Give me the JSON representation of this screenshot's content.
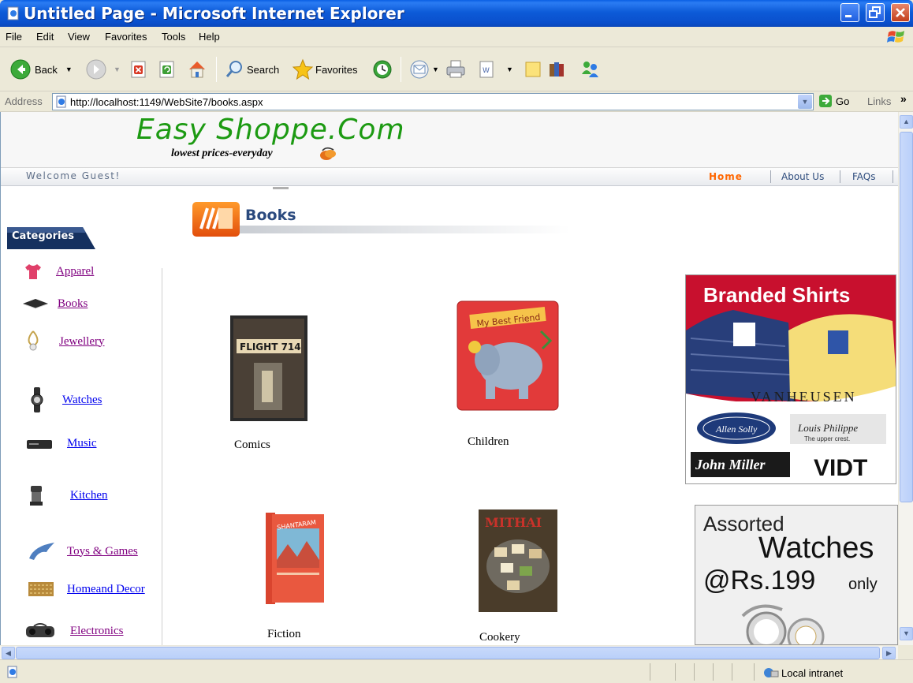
{
  "window": {
    "title": "Untitled Page - Microsoft Internet Explorer"
  },
  "menu": [
    "File",
    "Edit",
    "View",
    "Favorites",
    "Tools",
    "Help"
  ],
  "toolbar": {
    "back_label": "Back",
    "search_label": "Search",
    "favorites_label": "Favorites"
  },
  "address": {
    "label": "Address",
    "url": "http://localhost:1149/WebSite7/books.aspx",
    "go_label": "Go",
    "links_label": "Links",
    "links_chevron": "»"
  },
  "site": {
    "logo": "Easy Shoppe.Com",
    "tagline": "lowest prices-everyday",
    "welcome": "Welcome Guest!",
    "nav": [
      "Home",
      "About Us",
      "FAQs"
    ]
  },
  "categories": {
    "header": "Categories",
    "items": [
      {
        "label": "Apparel",
        "icon": "tshirt-icon",
        "visited": true
      },
      {
        "label": "Books",
        "icon": "book-icon",
        "visited": true
      },
      {
        "label": "Jewellery",
        "icon": "jewellery-icon",
        "visited": true
      },
      {
        "label": "Watches",
        "icon": "watch-icon",
        "visited": false
      },
      {
        "label": "Music",
        "icon": "music-player-icon",
        "visited": false
      },
      {
        "label": "Kitchen",
        "icon": "mixer-icon",
        "visited": false
      },
      {
        "label": "Toys & Games",
        "icon": "toy-icon",
        "visited": true
      },
      {
        "label": "Homeand Decor",
        "icon": "decor-icon",
        "visited": false
      },
      {
        "label": "Electronics",
        "icon": "boombox-icon",
        "visited": true
      }
    ]
  },
  "page_heading": "Books",
  "books": [
    {
      "label": "Comics",
      "cover_text": "FLIGHT 714"
    },
    {
      "label": "Children",
      "cover_text": "My Best Friend"
    },
    {
      "label": "Fiction",
      "cover_text": "SHANTARAM"
    },
    {
      "label": "Cookery",
      "cover_text": "MITHAI"
    }
  ],
  "ads": {
    "shirts": {
      "headline": "Branded Shirts",
      "brand1": "VANHEUSEN",
      "brand2": "Allen Solly",
      "brand3": "Louis Philippe",
      "brand3_sub": "The upper crest.",
      "brand4": "John Miller",
      "brand5": "VIDT"
    },
    "watches": {
      "line1": "Assorted",
      "line2": "Watches",
      "line3a": "@Rs.199",
      "line3b": "only"
    }
  },
  "status": {
    "zone": "Local intranet"
  },
  "colors": {
    "title_blue": "#0A4FCC",
    "logo_green": "#1C9A12",
    "nav_active": "#FF6600",
    "visited_link": "#800080",
    "link": "#0000EE",
    "ad_red": "#C8102E"
  }
}
